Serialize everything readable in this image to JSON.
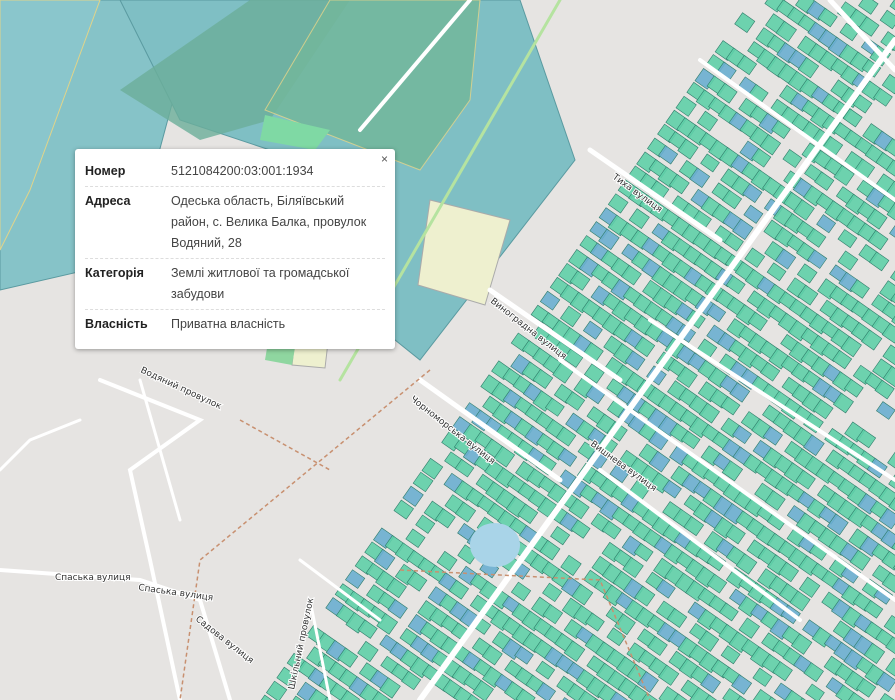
{
  "popup": {
    "close_label": "×",
    "rows": [
      {
        "key": "Номер",
        "value": "5121084200:03:001:1934"
      },
      {
        "key": "Адреса",
        "value": "Одеська область, Біляївський район, с. Велика Балка, провулок Водяний, 28"
      },
      {
        "key": "Категорія",
        "value": "Землі житлової та громадської забудови"
      },
      {
        "key": "Власність",
        "value": "Приватна власність"
      }
    ]
  },
  "streets": {
    "vodyanyi": "Водяний провулок",
    "spaska1": "Спаська вулиця",
    "spaska2": "Спаська вулиця",
    "vynohradna": "Виноградна вулиця",
    "tykha": "Тиха вулиця",
    "chornomorska": "Чорноморська вулиця",
    "vyshneva": "Вишнева вулиця",
    "shkilnyi": "Шкільний провулок",
    "sadova": "Садова вулиця"
  },
  "colors": {
    "parcel_green": "#5fcfa8",
    "parcel_blue": "#6aaed0",
    "field": "#7fbfc4",
    "road": "#ffffff",
    "marker": "#6b0a0a"
  }
}
